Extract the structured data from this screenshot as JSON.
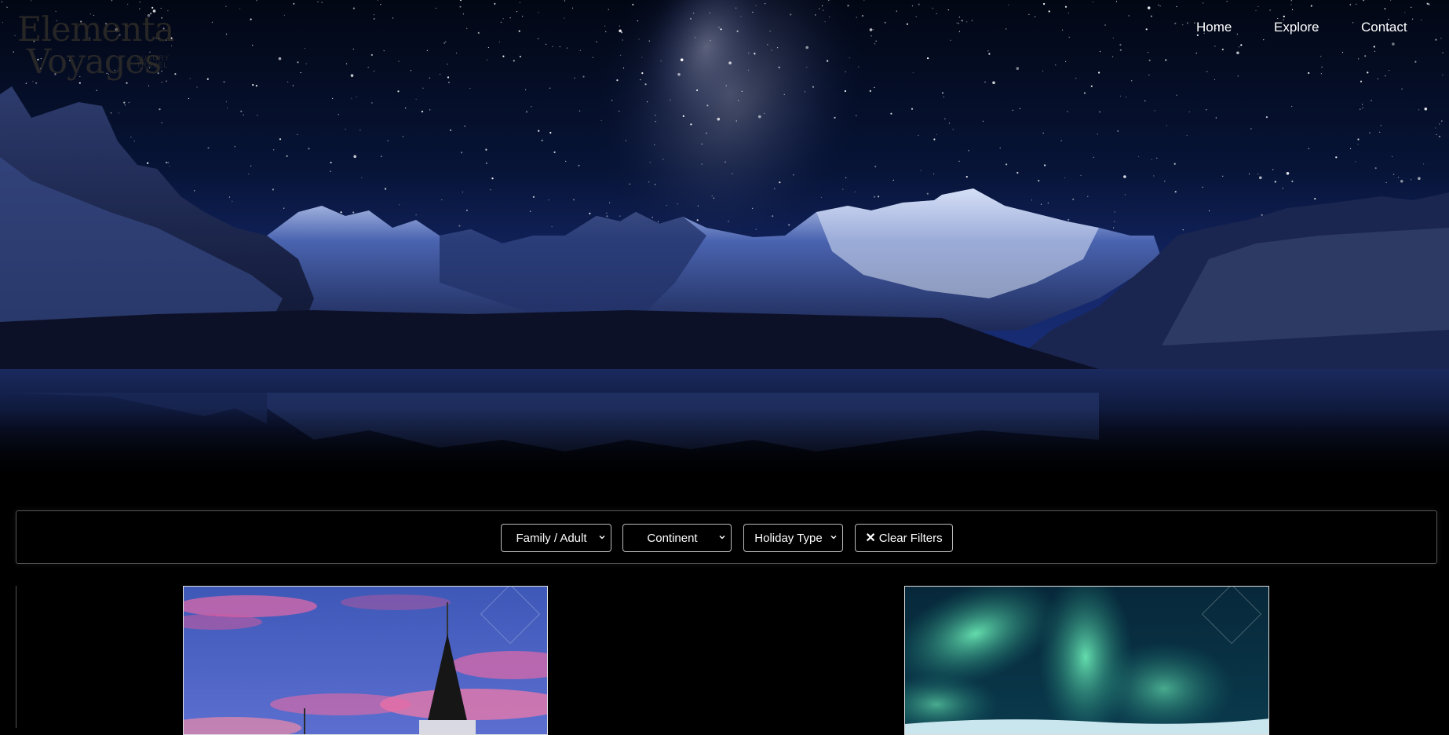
{
  "brand": {
    "line1": "Elementa",
    "line2": "Voyages",
    "tagline": "LUXURY TRAVEL"
  },
  "nav": {
    "home": "Home",
    "explore": "Explore",
    "contact": "Contact"
  },
  "filters": {
    "family_adult": "Family / Adult",
    "continent": "Continent",
    "holiday_type": "Holiday Type",
    "clear": "Clear Filters",
    "clear_icon": "✕"
  },
  "cards": [
    {
      "image": "church-spire-at-pink-sunset"
    },
    {
      "image": "northern-lights-over-snow"
    }
  ],
  "colors": {
    "background": "#000000",
    "sky_top": "#020617",
    "sky_mid": "#0c1c52",
    "text": "#ffffff",
    "border": "#555555"
  }
}
